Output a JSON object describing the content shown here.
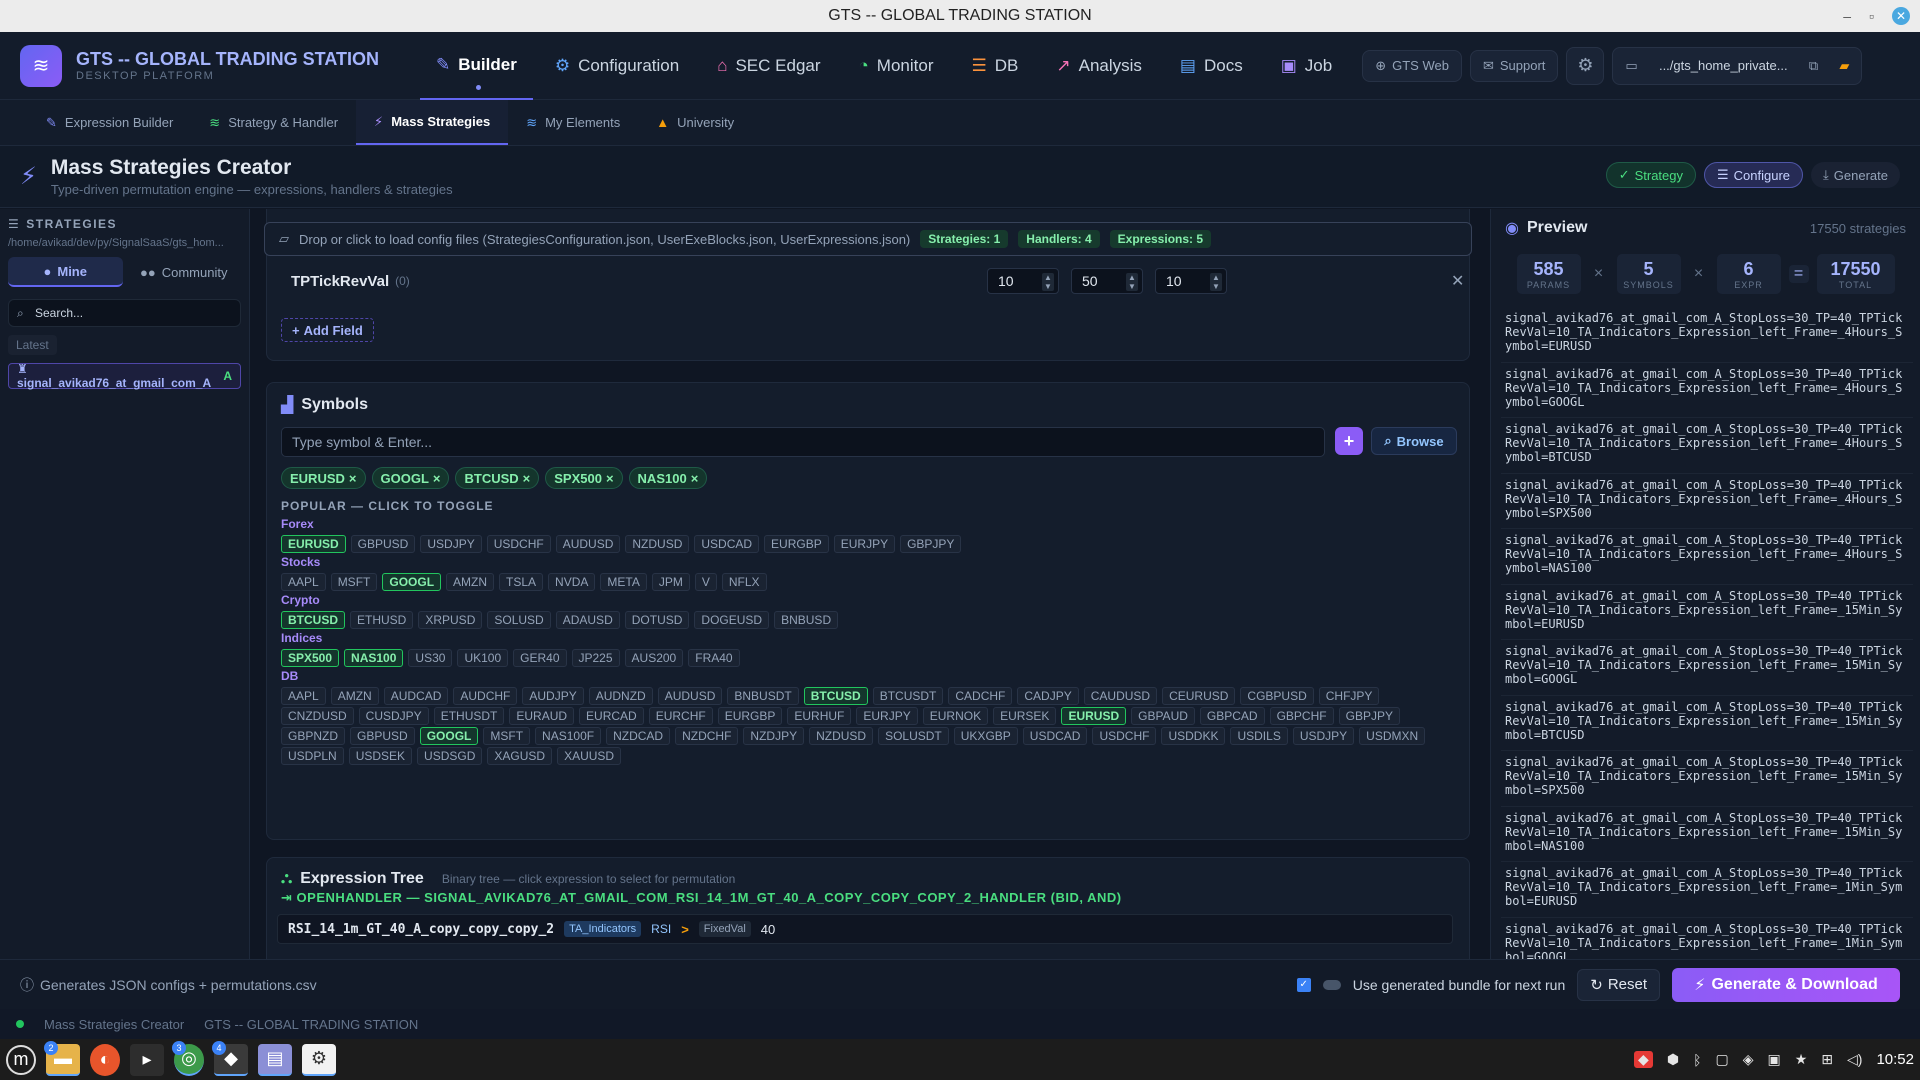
{
  "window": {
    "title": "GTS -- GLOBAL TRADING STATION"
  },
  "brand": {
    "title": "GTS -- GLOBAL TRADING STATION",
    "subtitle": "DESKTOP PLATFORM"
  },
  "nav": {
    "items": [
      {
        "label": "Builder",
        "icon": "wand-icon",
        "active": true
      },
      {
        "label": "Configuration",
        "icon": "gear-icon"
      },
      {
        "label": "SEC Edgar",
        "icon": "bank-icon"
      },
      {
        "label": "Monitor",
        "icon": "gauge-icon"
      },
      {
        "label": "DB",
        "icon": "database-icon"
      },
      {
        "label": "Analysis",
        "icon": "chart-icon"
      },
      {
        "label": "Docs",
        "icon": "book-icon"
      },
      {
        "label": "Job",
        "icon": "briefcase-icon"
      }
    ],
    "gts_web": "GTS Web",
    "support": "Support",
    "path": ".../gts_home_private..."
  },
  "sub_tabs": [
    {
      "label": "Expression Builder",
      "active": false
    },
    {
      "label": "Strategy & Handler",
      "active": false
    },
    {
      "label": "Mass Strategies",
      "active": true
    },
    {
      "label": "My Elements",
      "active": false
    },
    {
      "label": "University",
      "active": false
    }
  ],
  "page": {
    "title": "Mass Strategies Creator",
    "subtitle": "Type-driven permutation engine — expressions, handlers & strategies",
    "steps": {
      "strategy": "Strategy",
      "configure": "Configure",
      "generate": "Generate"
    }
  },
  "sidebar": {
    "title": "STRATEGIES",
    "path": "/home/avikad/dev/py/SignalSaaS/gts_hom...",
    "mine": "Mine",
    "community": "Community",
    "search_placeholder": "Search...",
    "latest": "Latest",
    "item": "signal_avikad76_at_gmail_com_A",
    "item_badge": "A"
  },
  "config": {
    "drop_text": "Drop or click to load config files (StrategiesConfiguration.json, UserExeBlocks.json, UserExpressions.json)",
    "badges": {
      "strategies": "Strategies: 1",
      "handlers": "Handlers: 4",
      "expressions": "Expressions: 5"
    },
    "field": {
      "name": "TPTickRevVal",
      "count": "(0)",
      "start": "10",
      "end": "50",
      "step": "10"
    },
    "add_field": "Add Field"
  },
  "symbols": {
    "title": "Symbols",
    "placeholder": "Type symbol & Enter...",
    "browse": "Browse",
    "selected": [
      "EURUSD",
      "GOOGL",
      "BTCUSD",
      "SPX500",
      "NAS100"
    ],
    "popular_title": "POPULAR — CLICK TO TOGGLE",
    "categories": [
      {
        "label": "Forex",
        "items": [
          "EURUSD",
          "GBPUSD",
          "USDJPY",
          "USDCHF",
          "AUDUSD",
          "NZDUSD",
          "USDCAD",
          "EURGBP",
          "EURJPY",
          "GBPJPY"
        ]
      },
      {
        "label": "Stocks",
        "items": [
          "AAPL",
          "MSFT",
          "GOOGL",
          "AMZN",
          "TSLA",
          "NVDA",
          "META",
          "JPM",
          "V",
          "NFLX"
        ]
      },
      {
        "label": "Crypto",
        "items": [
          "BTCUSD",
          "ETHUSD",
          "XRPUSD",
          "SOLUSD",
          "ADAUSD",
          "DOTUSD",
          "DOGEUSD",
          "BNBUSD"
        ]
      },
      {
        "label": "Indices",
        "items": [
          "SPX500",
          "NAS100",
          "US30",
          "UK100",
          "GER40",
          "JP225",
          "AUS200",
          "FRA40"
        ]
      },
      {
        "label": "DB",
        "items": [
          "AAPL",
          "AMZN",
          "AUDCAD",
          "AUDCHF",
          "AUDJPY",
          "AUDNZD",
          "AUDUSD",
          "BNBUSDT",
          "BTCUSD",
          "BTCUSDT",
          "CADCHF",
          "CADJPY",
          "CAUDUSD",
          "CEURUSD",
          "CGBPUSD",
          "CHFJPY",
          "CNZDUSD",
          "CUSDJPY",
          "ETHUSDT",
          "EURAUD",
          "EURCAD",
          "EURCHF",
          "EURGBP",
          "EURHUF",
          "EURJPY",
          "EURNOK",
          "EURSEK",
          "EURUSD",
          "GBPAUD",
          "GBPCAD",
          "GBPCHF",
          "GBPJPY",
          "GBPNZD",
          "GBPUSD",
          "GOOGL",
          "MSFT",
          "NAS100F",
          "NZDCAD",
          "NZDCHF",
          "NZDJPY",
          "NZDUSD",
          "SOLUSDT",
          "UKXGBP",
          "USDCAD",
          "USDCHF",
          "USDDKK",
          "USDILS",
          "USDJPY",
          "USDMXN",
          "USDPLN",
          "USDSEK",
          "USDSGD",
          "XAGUSD",
          "XAUUSD"
        ]
      }
    ]
  },
  "expression_tree": {
    "title": "Expression Tree",
    "subtitle": "Binary tree — click expression to select for permutation",
    "handler": "OPENHANDLER — SIGNAL_AVIKAD76_AT_GMAIL_COM_RSI_14_1M_GT_40_A_COPY_COPY_COPY_2_HANDLER (BID, AND)",
    "expr_name": "RSI_14_1m_GT_40_A_copy_copy_copy_2",
    "expr_source": "TA_Indicators",
    "expr_ind": "RSI",
    "expr_op": ">",
    "expr_type": "FixedVal",
    "expr_val": "40"
  },
  "preview": {
    "title": "Preview",
    "count": "17550 strategies",
    "params": "585",
    "params_label": "PARAMS",
    "symbols": "5",
    "symbols_label": "SYMBOLS",
    "expr": "6",
    "expr_label": "EXPR",
    "total": "17550",
    "total_label": "TOTAL",
    "items": [
      "signal_avikad76_at_gmail_com_A_StopLoss=30_TP=40_TPTickRevVal=10_TA_Indicators_Expression_left_Frame=_4Hours_Symbol=EURUSD",
      "signal_avikad76_at_gmail_com_A_StopLoss=30_TP=40_TPTickRevVal=10_TA_Indicators_Expression_left_Frame=_4Hours_Symbol=GOOGL",
      "signal_avikad76_at_gmail_com_A_StopLoss=30_TP=40_TPTickRevVal=10_TA_Indicators_Expression_left_Frame=_4Hours_Symbol=BTCUSD",
      "signal_avikad76_at_gmail_com_A_StopLoss=30_TP=40_TPTickRevVal=10_TA_Indicators_Expression_left_Frame=_4Hours_Symbol=SPX500",
      "signal_avikad76_at_gmail_com_A_StopLoss=30_TP=40_TPTickRevVal=10_TA_Indicators_Expression_left_Frame=_4Hours_Symbol=NAS100",
      "signal_avikad76_at_gmail_com_A_StopLoss=30_TP=40_TPTickRevVal=10_TA_Indicators_Expression_left_Frame=_15Min_Symbol=EURUSD",
      "signal_avikad76_at_gmail_com_A_StopLoss=30_TP=40_TPTickRevVal=10_TA_Indicators_Expression_left_Frame=_15Min_Symbol=GOOGL",
      "signal_avikad76_at_gmail_com_A_StopLoss=30_TP=40_TPTickRevVal=10_TA_Indicators_Expression_left_Frame=_15Min_Symbol=BTCUSD",
      "signal_avikad76_at_gmail_com_A_StopLoss=30_TP=40_TPTickRevVal=10_TA_Indicators_Expression_left_Frame=_15Min_Symbol=SPX500",
      "signal_avikad76_at_gmail_com_A_StopLoss=30_TP=40_TPTickRevVal=10_TA_Indicators_Expression_left_Frame=_15Min_Symbol=NAS100",
      "signal_avikad76_at_gmail_com_A_StopLoss=30_TP=40_TPTickRevVal=10_TA_Indicators_Expression_left_Frame=_1Min_Symbol=EURUSD",
      "signal_avikad76_at_gmail_com_A_StopLoss=30_TP=40_TPTickRevVal=10_TA_Indicators_Expression_left_Frame=_1Min_Symbol=GOOGL"
    ]
  },
  "action_bar": {
    "info": "Generates JSON configs + permutations.csv",
    "use_bundle": "Use generated bundle for next run",
    "reset": "Reset",
    "generate": "Generate & Download"
  },
  "status_bar": {
    "left": "Mass Strategies Creator",
    "right": "GTS -- GLOBAL TRADING STATION"
  },
  "taskbar": {
    "clock": "10:52",
    "badges": [
      "2",
      "3",
      "4"
    ]
  }
}
